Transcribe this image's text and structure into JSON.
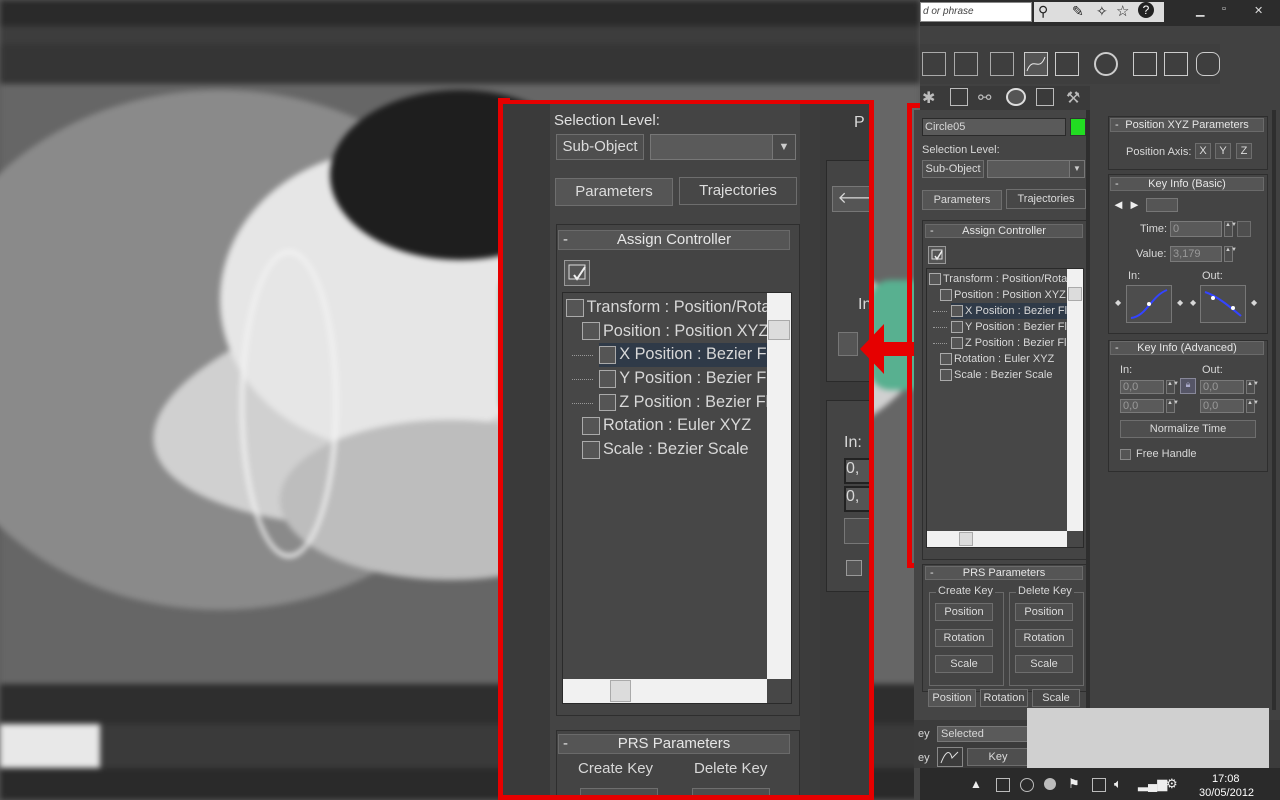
{
  "topbar": {
    "search_placeholder": "d or phrase",
    "window_controls": {
      "minimize": "▁",
      "restore": "▫",
      "close": "✕"
    }
  },
  "panel": {
    "object_name": "Circle05",
    "object_color": "#22dd22",
    "selection_level_label": "Selection Level:",
    "sub_object_label": "Sub-Object",
    "tabs": {
      "parameters": "Parameters",
      "trajectories": "Trajectories"
    },
    "assign_controller": {
      "title": "Assign Controller",
      "tree": [
        {
          "label": "Transform : Position/Rotat",
          "indent": 0,
          "icon": "transform-icon",
          "selected": false
        },
        {
          "label": "Position : Position XYZ",
          "indent": 1,
          "icon": "position-xyz-icon",
          "selected": false
        },
        {
          "label": "X Position : Bezier Fl",
          "indent": 2,
          "icon": "bezier-float-icon",
          "selected": true
        },
        {
          "label": "Y Position : Bezier Fl",
          "indent": 2,
          "icon": "bezier-float-icon",
          "selected": false
        },
        {
          "label": "Z Position : Bezier Fl",
          "indent": 2,
          "icon": "bezier-float-icon",
          "selected": false
        },
        {
          "label": "Rotation : Euler XYZ",
          "indent": 1,
          "icon": "euler-rotation-icon",
          "selected": false
        },
        {
          "label": "Scale : Bezier Scale",
          "indent": 1,
          "icon": "bezier-scale-icon",
          "selected": false
        }
      ]
    },
    "prs": {
      "title": "PRS Parameters",
      "create_key": "Create Key",
      "delete_key": "Delete Key",
      "position": "Position",
      "rotation": "Rotation",
      "scale": "Scale",
      "bottom_tabs": [
        "Position",
        "Rotation",
        "Scale"
      ]
    }
  },
  "right_panel": {
    "position_xyz": {
      "title": "Position XYZ Parameters",
      "axis_label": "Position Axis:",
      "axes": [
        "X",
        "Y",
        "Z"
      ]
    },
    "key_info_basic": {
      "title": "Key Info (Basic)",
      "time_label": "Time:",
      "time_value": "0",
      "value_label": "Value:",
      "value_value": "3,179",
      "in_label": "In:",
      "out_label": "Out:"
    },
    "key_info_advanced": {
      "title": "Key Info (Advanced)",
      "in_label": "In:",
      "out_label": "Out:",
      "in_values": [
        "0,0",
        "0,0"
      ],
      "out_values": [
        "0,0",
        "0,0"
      ],
      "normalize_time": "Normalize Time",
      "free_handle": "Free Handle"
    }
  },
  "bottom": {
    "selected_value": "Selected",
    "key_filters": "Key Filters...",
    "clock_time": "17:08",
    "clock_date": "30/05/2012"
  },
  "zoom_inset": {
    "partial_letters": [
      "P",
      "In:",
      "0,",
      "0,",
      "Position",
      "Positio"
    ]
  },
  "colors": {
    "highlight_red": "#e60000",
    "panel_bg": "#444444",
    "selected_row": "#2f3a48"
  }
}
